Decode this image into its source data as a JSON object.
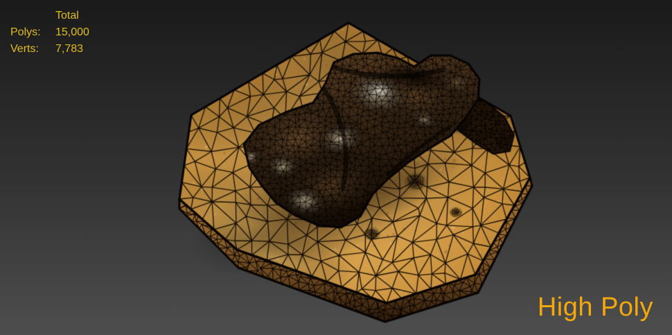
{
  "stats": {
    "header": "Total",
    "rows": [
      {
        "label": "Polys:",
        "value": "15,000"
      },
      {
        "label": "Verts:",
        "value": "7,783"
      }
    ]
  },
  "caption": {
    "text": "High Poly"
  },
  "colors": {
    "background_top": "#1a1a1a",
    "background_bottom": "#4e4e4e",
    "stats_text": "#e1be19",
    "caption_text": "#f4a80c",
    "wireframe": "rgba(10,5,0,0.92)",
    "disc_light": "#e3ae58",
    "disc_mid": "#cc9440",
    "disc_edge": "#b07a2e",
    "rim_top": "#9a6a30",
    "rim_bottom": "#2a180a",
    "blob_dark": "#20150c",
    "blob_brown": "#6e4e2e",
    "blob_highlight": "#ded1b2",
    "shadow": "rgba(30,18,8,0.5)"
  }
}
